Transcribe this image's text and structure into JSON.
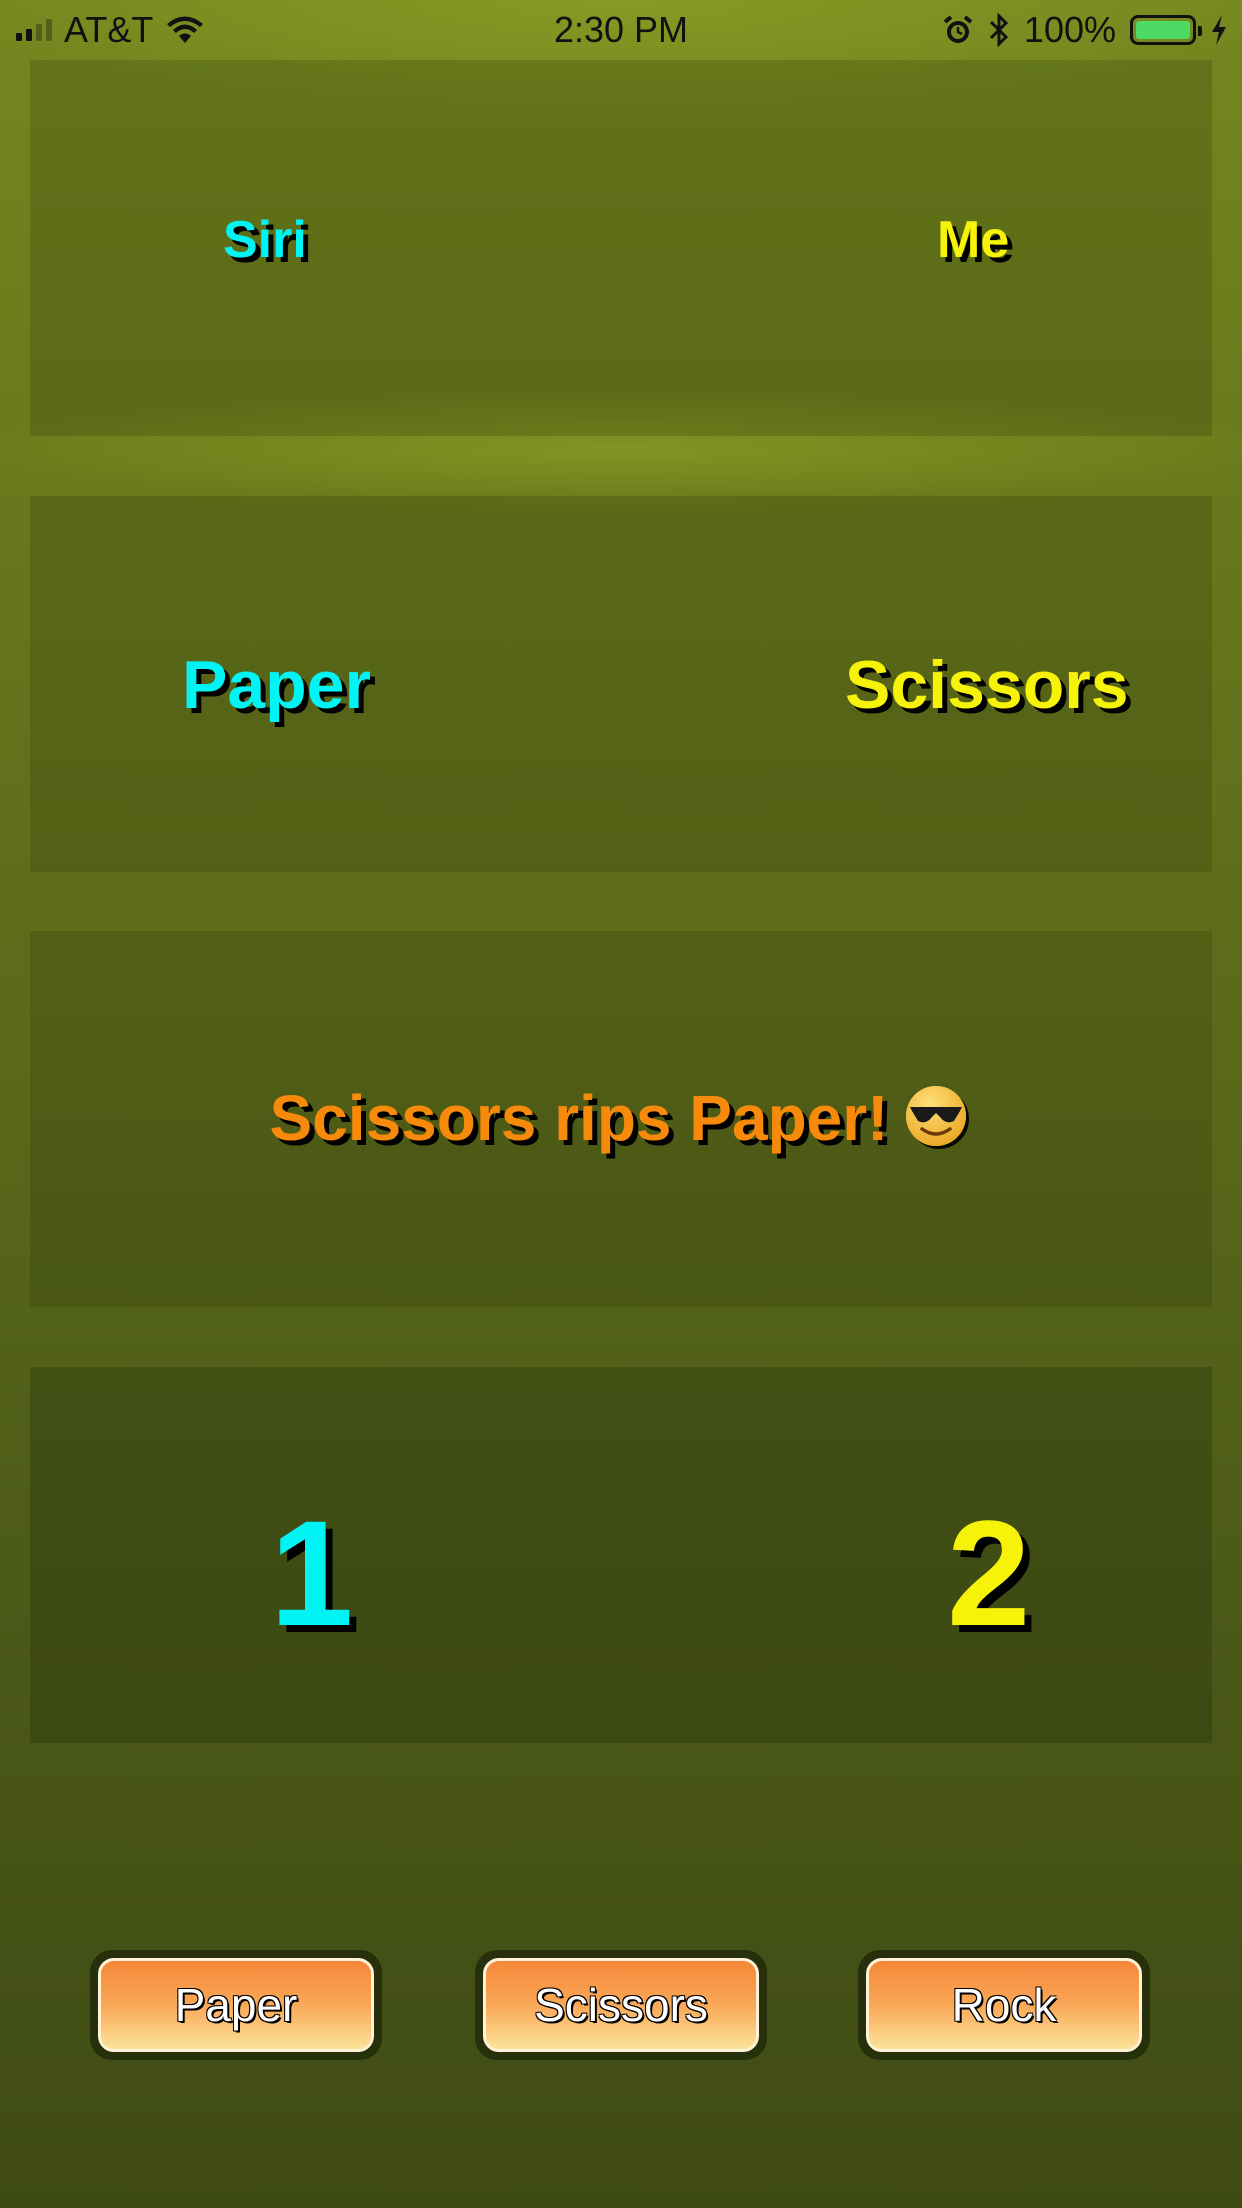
{
  "status_bar": {
    "carrier": "AT&T",
    "time": "2:30 PM",
    "battery_percent": "100%",
    "battery_level": 1.0,
    "icons": [
      "signal-bars-icon",
      "wifi-icon",
      "alarm-icon",
      "bluetooth-icon",
      "battery-icon",
      "charging-bolt-icon"
    ]
  },
  "players": {
    "siri_label": "Siri",
    "me_label": "Me"
  },
  "choices": {
    "siri": "Paper",
    "me": "Scissors"
  },
  "result": {
    "message": "Scissors rips Paper!",
    "emoji": "smiling-face-with-sunglasses-icon"
  },
  "scores": {
    "siri": "1",
    "me": "2"
  },
  "buttons": {
    "paper": "Paper",
    "scissors": "Scissors",
    "rock": "Rock"
  },
  "colors": {
    "siri": "#00f4f4",
    "me": "#f7f20a",
    "result": "#f78a0a",
    "button_top": "#f6873a",
    "button_bottom": "#fde39a",
    "background": "#5c6b1a"
  }
}
